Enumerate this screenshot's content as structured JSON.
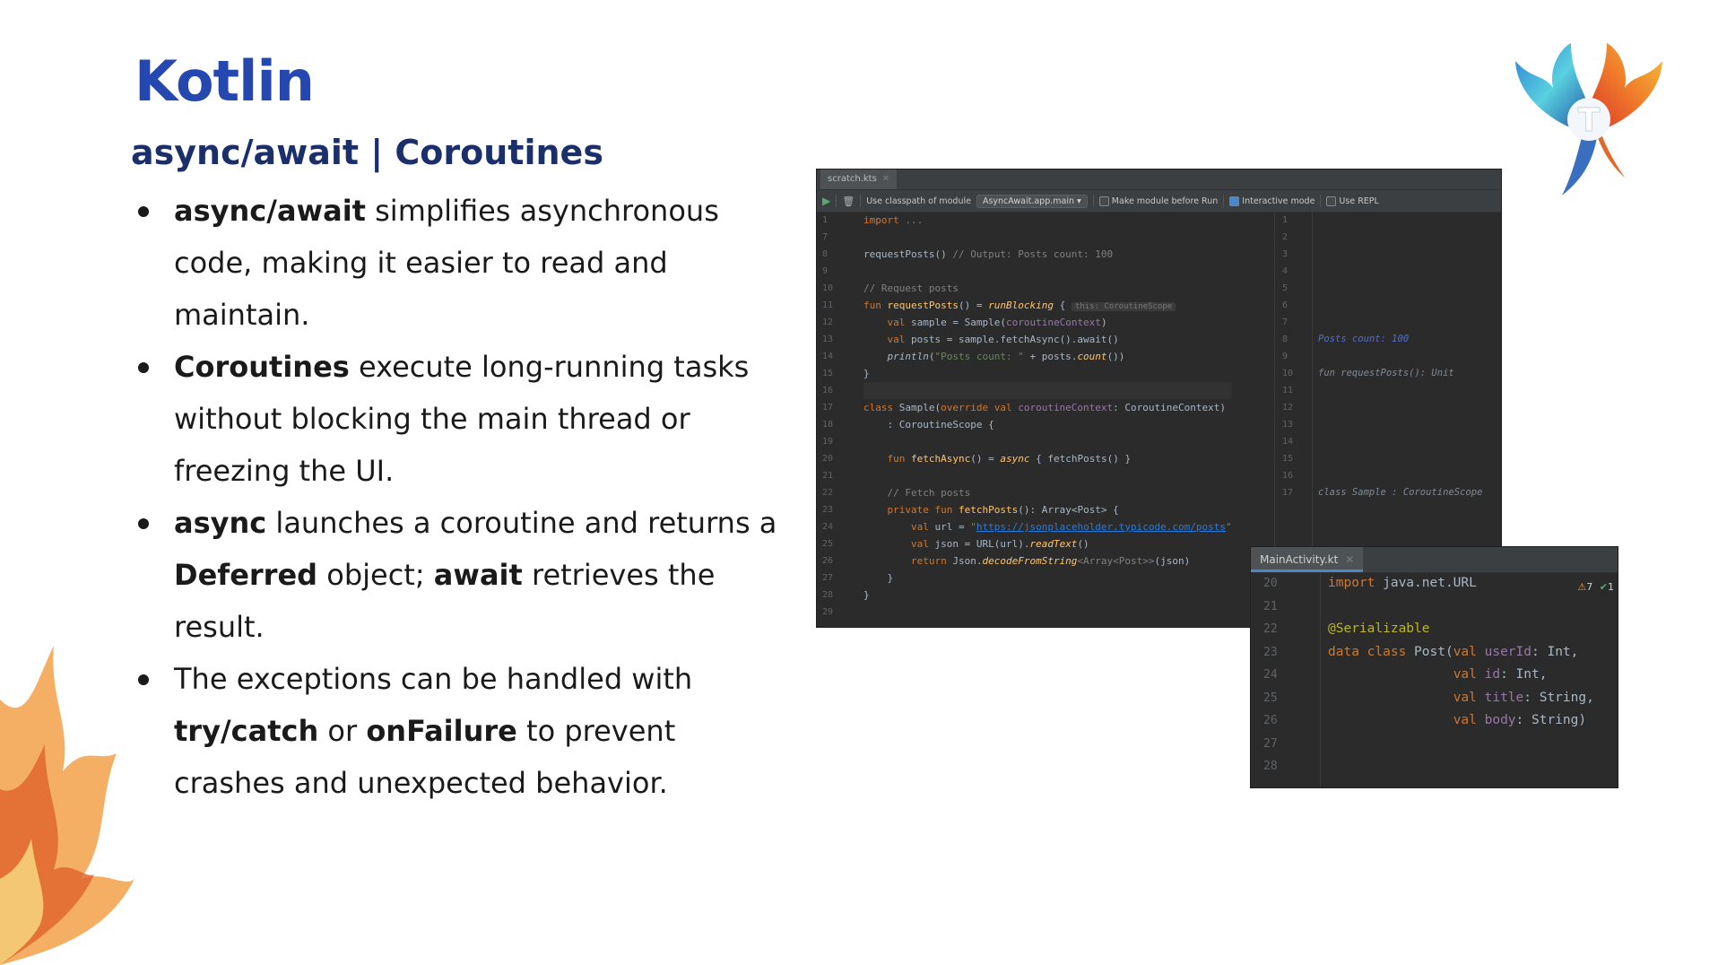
{
  "slide": {
    "title": "Kotlin",
    "subtitle": "async/await | Coroutines",
    "bullets": [
      {
        "parts": [
          {
            "b": "async/await"
          },
          {
            "t": " simplifies asynchronous code, making it easier to read and maintain."
          }
        ]
      },
      {
        "parts": [
          {
            "b": "Coroutines"
          },
          {
            "t": " execute long-running tasks without blocking the main thread or freezing the UI."
          }
        ]
      },
      {
        "parts": [
          {
            "b": "async"
          },
          {
            "t": " launches a coroutine and returns a "
          },
          {
            "b": "Deferred"
          },
          {
            "t": " object; "
          },
          {
            "b": "await"
          },
          {
            "t": " retrieves the result."
          }
        ]
      },
      {
        "parts": [
          {
            "t": "The exceptions can be handled with "
          },
          {
            "b": "try/catch"
          },
          {
            "t": " or "
          },
          {
            "b": "onFailure"
          },
          {
            "t": " to prevent crashes and unexpected behavior."
          }
        ]
      }
    ],
    "logo_letter": "T",
    "colors": {
      "title": "#2547b0",
      "subtitle": "#1b2f6b",
      "ide_bg": "#2b2b2b"
    }
  },
  "scratch": {
    "tab_label": "scratch.kts",
    "toolbar": {
      "classpath_label": "Use classpath of module",
      "module": "AsyncAwait.app.main",
      "make_module": "Make module before Run",
      "interactive": "Interactive mode",
      "use_repl": "Use REPL"
    },
    "line_numbers": [
      "1",
      "7",
      "8",
      "9",
      "10",
      "11",
      "12",
      "13",
      "14",
      "15",
      "16",
      "17",
      "18",
      "19",
      "20",
      "21",
      "22",
      "23",
      "24",
      "25",
      "26",
      "27",
      "28",
      "29"
    ],
    "code_lines": [
      [
        {
          "c": "kw",
          "t": "import"
        },
        {
          "c": "cm",
          "t": " ..."
        }
      ],
      [],
      [
        {
          "t": "requestPosts() "
        },
        {
          "c": "cm",
          "t": "// Output: Posts count: 100"
        }
      ],
      [],
      [
        {
          "c": "cm",
          "t": "// Request posts"
        }
      ],
      [
        {
          "c": "kw",
          "t": "fun "
        },
        {
          "c": "fn",
          "t": "requestPosts"
        },
        {
          "t": "() = "
        },
        {
          "c": "fn it",
          "t": "runBlocking"
        },
        {
          "t": " { "
        },
        {
          "c": "hint",
          "t": "this: CoroutineScope"
        }
      ],
      [
        {
          "t": "    "
        },
        {
          "c": "kw",
          "t": "val "
        },
        {
          "t": "sample = Sample("
        },
        {
          "c": "pr",
          "t": "coroutineContext"
        },
        {
          "t": ")"
        }
      ],
      [
        {
          "t": "    "
        },
        {
          "c": "kw",
          "t": "val "
        },
        {
          "t": "posts = sample.fetchAsync().await()"
        }
      ],
      [
        {
          "t": "    "
        },
        {
          "c": "it",
          "t": "println"
        },
        {
          "t": "("
        },
        {
          "c": "st",
          "t": "\"Posts count: \""
        },
        {
          "t": " + posts."
        },
        {
          "c": "fn it",
          "t": "count"
        },
        {
          "t": "())"
        }
      ],
      [
        {
          "t": "}"
        }
      ],
      [],
      [
        {
          "c": "kw",
          "t": "class "
        },
        {
          "t": "Sample("
        },
        {
          "c": "kw",
          "t": "override val "
        },
        {
          "c": "pr",
          "t": "coroutineContext"
        },
        {
          "t": ": CoroutineContext)"
        }
      ],
      [
        {
          "t": "    : CoroutineScope {"
        }
      ],
      [],
      [
        {
          "t": "    "
        },
        {
          "c": "kw",
          "t": "fun "
        },
        {
          "c": "fn",
          "t": "fetchAsync"
        },
        {
          "t": "() = "
        },
        {
          "c": "fn it",
          "t": "async"
        },
        {
          "t": " { fetchPosts() }"
        }
      ],
      [],
      [
        {
          "t": "    "
        },
        {
          "c": "cm",
          "t": "// Fetch posts"
        }
      ],
      [
        {
          "t": "    "
        },
        {
          "c": "kw",
          "t": "private fun "
        },
        {
          "c": "fn",
          "t": "fetchPosts"
        },
        {
          "t": "(): Array<Post> {"
        }
      ],
      [
        {
          "t": "        "
        },
        {
          "c": "kw",
          "t": "val "
        },
        {
          "t": "url = "
        },
        {
          "c": "st",
          "t": "\""
        },
        {
          "c": "lk",
          "t": "https://jsonplaceholder.typicode.com/posts"
        },
        {
          "c": "st",
          "t": "\""
        }
      ],
      [
        {
          "t": "        "
        },
        {
          "c": "kw",
          "t": "val "
        },
        {
          "t": "json = URL(url)."
        },
        {
          "c": "fn it",
          "t": "readText"
        },
        {
          "t": "()"
        }
      ],
      [
        {
          "t": "        "
        },
        {
          "c": "kw",
          "t": "return "
        },
        {
          "t": "Json."
        },
        {
          "c": "fn it",
          "t": "decodeFromString"
        },
        {
          "c": "cm",
          "t": "<Array<Post>>"
        },
        {
          "t": "(json)"
        }
      ],
      [
        {
          "t": "    }"
        }
      ],
      [
        {
          "t": "}"
        }
      ],
      []
    ],
    "result_line_numbers": [
      "1",
      "2",
      "3",
      "4",
      "5",
      "6",
      "7",
      "8",
      "9",
      "10",
      "11",
      "12",
      "13",
      "14",
      "15",
      "16",
      "17"
    ],
    "result_lines": [
      "",
      "",
      "",
      "",
      "",
      "",
      "",
      "Posts count: 100",
      "",
      "fun requestPosts(): Unit",
      "",
      "",
      "",
      "",
      "",
      "",
      "class Sample : CoroutineScope"
    ]
  },
  "main_activity": {
    "tab_label": "MainActivity.kt",
    "warnings": "7",
    "checks": "1",
    "line_numbers": [
      "20",
      "21",
      "22",
      "23",
      "24",
      "25",
      "26",
      "27",
      "28"
    ],
    "code_lines": [
      [
        {
          "c": "kw",
          "t": "import "
        },
        {
          "t": "java.net.URL"
        }
      ],
      [],
      [
        {
          "c": "an",
          "t": "@Serializable"
        }
      ],
      [
        {
          "c": "kw",
          "t": "data class "
        },
        {
          "t": "Post("
        },
        {
          "c": "kw",
          "t": "val "
        },
        {
          "c": "pr",
          "t": "userId"
        },
        {
          "t": ": Int,"
        }
      ],
      [
        {
          "t": "                "
        },
        {
          "c": "kw",
          "t": "val "
        },
        {
          "c": "pr",
          "t": "id"
        },
        {
          "t": ": Int,"
        }
      ],
      [
        {
          "t": "                "
        },
        {
          "c": "kw",
          "t": "val "
        },
        {
          "c": "pr",
          "t": "title"
        },
        {
          "t": ": String,"
        }
      ],
      [
        {
          "t": "                "
        },
        {
          "c": "kw",
          "t": "val "
        },
        {
          "c": "pr",
          "t": "body"
        },
        {
          "t": ": String)"
        }
      ],
      [],
      []
    ]
  }
}
